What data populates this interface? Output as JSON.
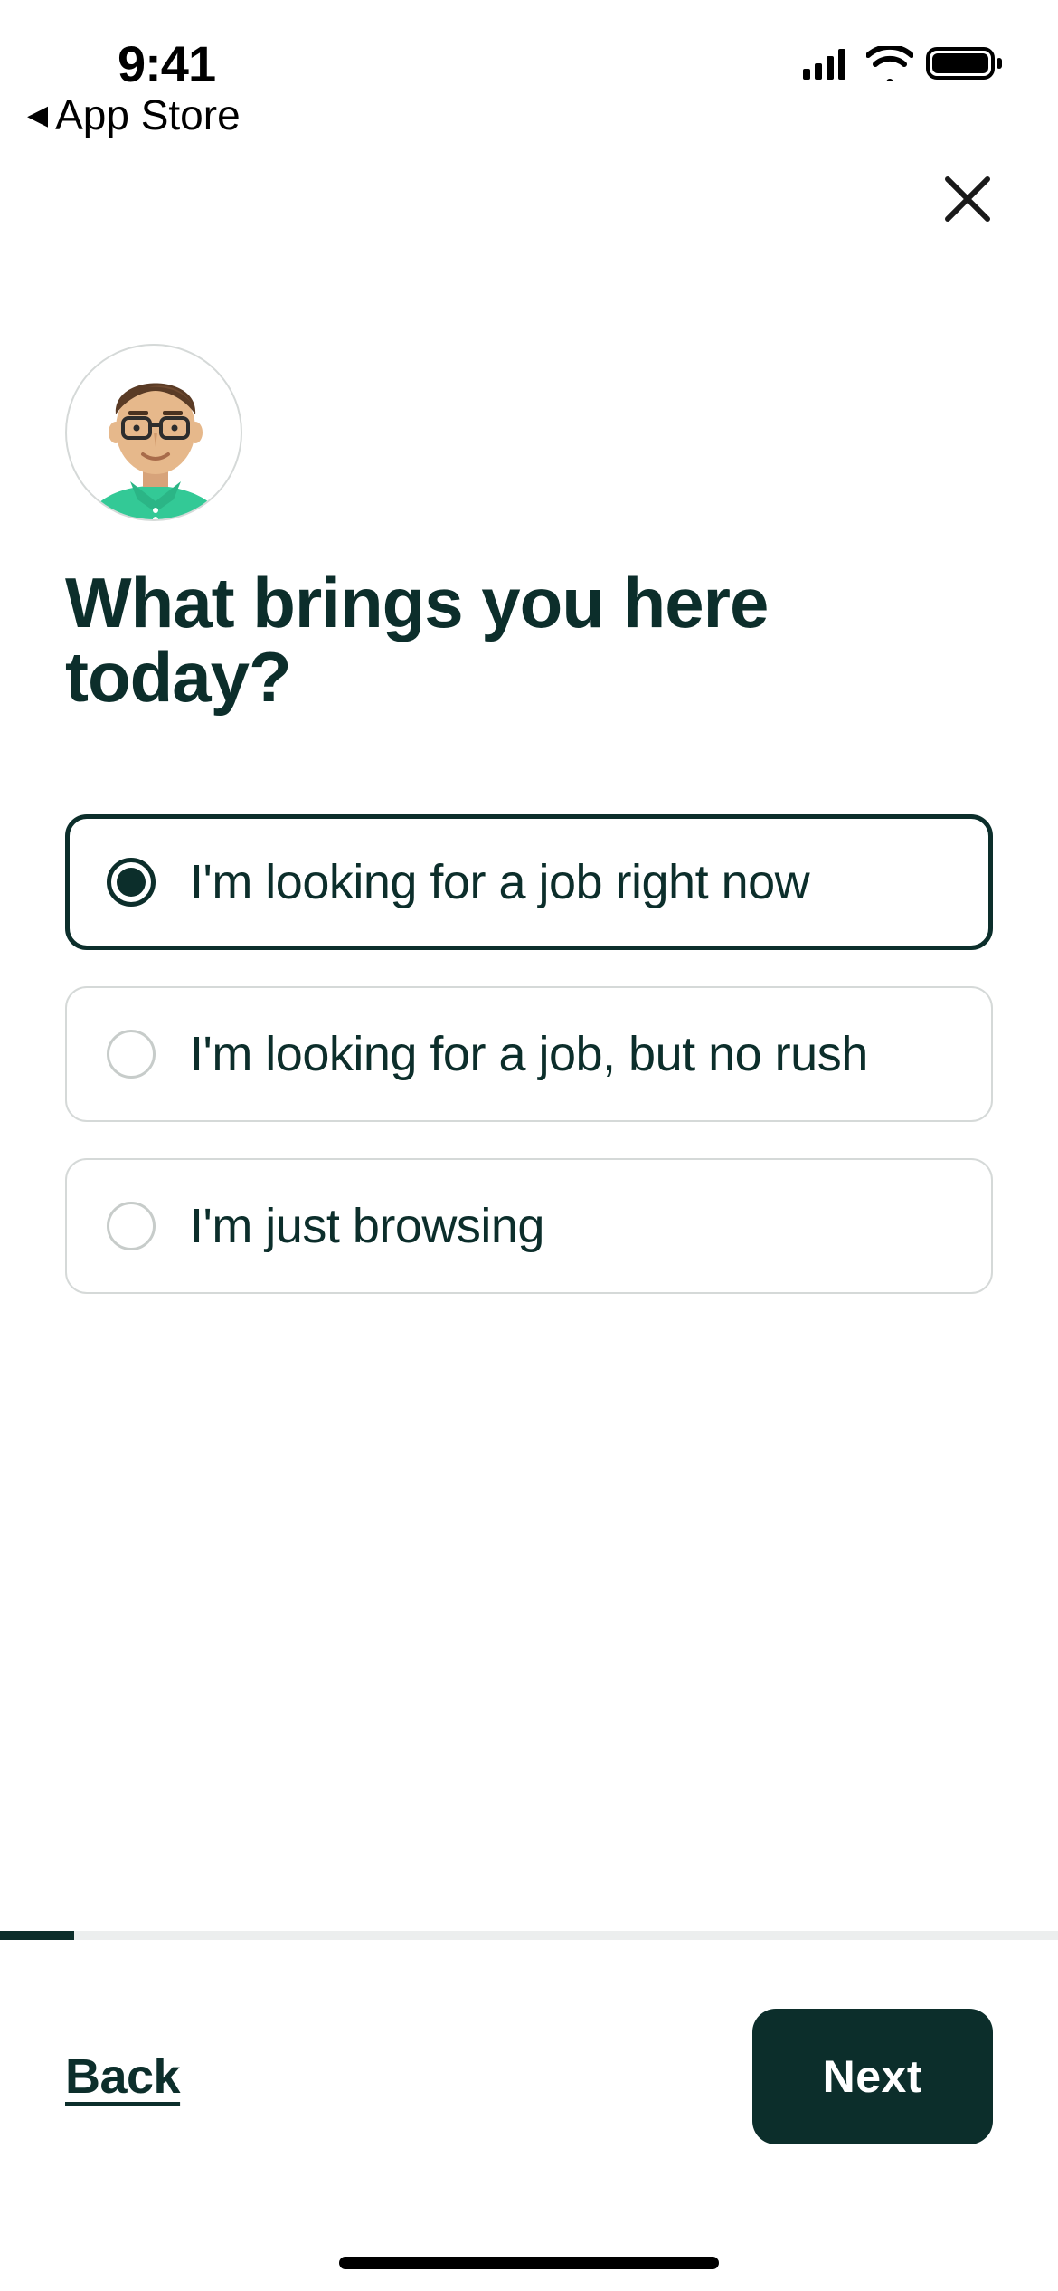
{
  "status": {
    "time": "9:41",
    "breadcrumb": "App Store"
  },
  "question": {
    "heading": "What brings you here today?",
    "options": [
      {
        "label": "I'm looking for a job right now",
        "selected": true
      },
      {
        "label": "I'm looking for a job, but no rush",
        "selected": false
      },
      {
        "label": "I'm just browsing",
        "selected": false
      }
    ]
  },
  "footer": {
    "back": "Back",
    "next": "Next"
  },
  "avatar": {
    "desc": "cartoon-person-glasses-green-shirt"
  }
}
